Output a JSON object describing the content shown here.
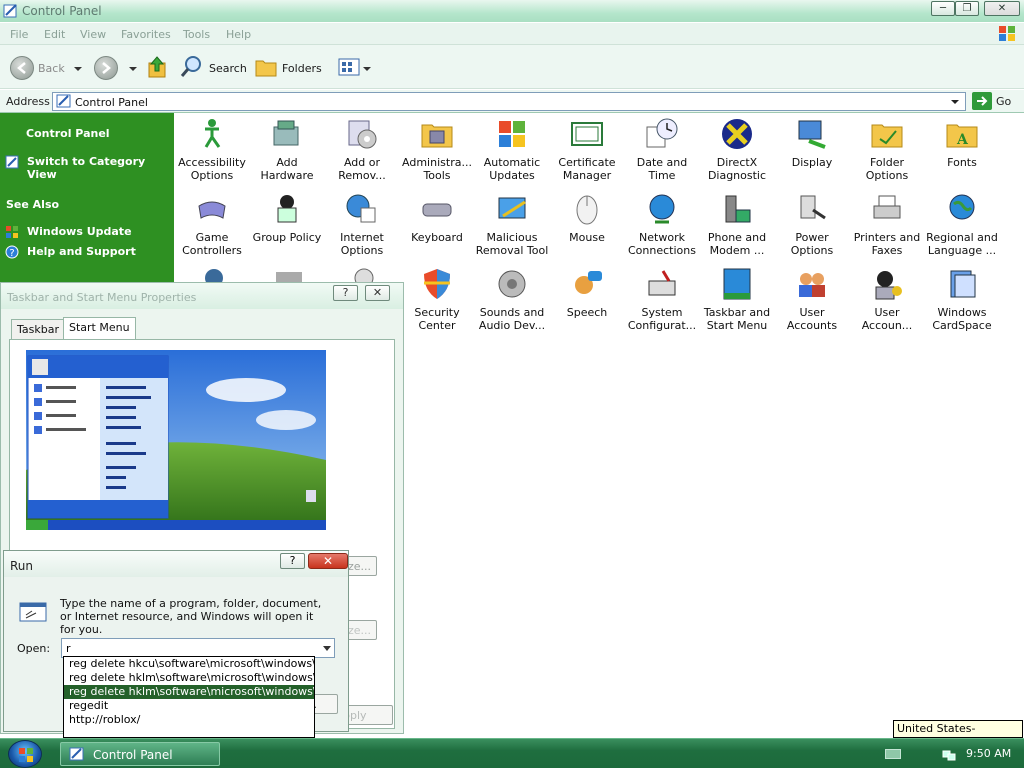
{
  "window": {
    "title": "Control Panel"
  },
  "menu": [
    "File",
    "Edit",
    "View",
    "Favorites",
    "Tools",
    "Help"
  ],
  "toolbar": {
    "back": "Back",
    "search": "Search",
    "folders": "Folders"
  },
  "address": {
    "label": "Address",
    "value": "Control Panel",
    "go": "Go"
  },
  "sidebar": {
    "title": "Control Panel",
    "switch_link": "Switch to Category View",
    "see_also": "See Also",
    "links": [
      "Windows Update",
      "Help and Support"
    ]
  },
  "items": [
    "Accessibility Options",
    "Add Hardware",
    "Add or Remov...",
    "Administra... Tools",
    "Automatic Updates",
    "Certificate Manager",
    "Date and Time",
    "DirectX Diagnostic",
    "Display",
    "Folder Options",
    "Fonts",
    "Game Controllers",
    "Group Policy",
    "Internet Options",
    "Keyboard",
    "Malicious Removal Tool",
    "Mouse",
    "Network Connections",
    "Phone and Modem ...",
    "Power Options",
    "Printers and Faxes",
    "Regional and Language ...",
    "Security Center",
    "Sounds and Audio Dev...",
    "Speech",
    "System Configurat...",
    "Taskbar and Start Menu",
    "User Accounts",
    "User Accoun...",
    "Windows CardSpace"
  ],
  "taskbar_dialog": {
    "title": "Taskbar and Start Menu Properties",
    "tabs": [
      "Taskbar",
      "Start Menu"
    ],
    "customize": "ze...",
    "customize2": "ze...",
    "apply": "pply",
    "help": "?",
    "close": "✕"
  },
  "run": {
    "title": "Run",
    "description": "Type the name of a program, folder, document, or Internet resource, and Windows will open it for you.",
    "open_label": "Open:",
    "input_value": "r",
    "ok_partial": "..",
    "help": "?",
    "close": "✕",
    "suggestions": [
      "reg delete hkcu\\software\\microsoft\\windows\\cu",
      "reg delete hklm\\software\\microsoft\\windows\\cu",
      "reg delete hklm\\software\\microsoft\\windows\\cu",
      "regedit",
      "http://roblox/"
    ],
    "selected_index": 2
  },
  "taskbar": {
    "task_label": "Control Panel",
    "time": "9:50 AM",
    "language_tooltip": "United States-International"
  },
  "colors": {
    "sidebar": "#2e9022",
    "taskbar": "#1f6e3f",
    "selection": "#24612a"
  }
}
